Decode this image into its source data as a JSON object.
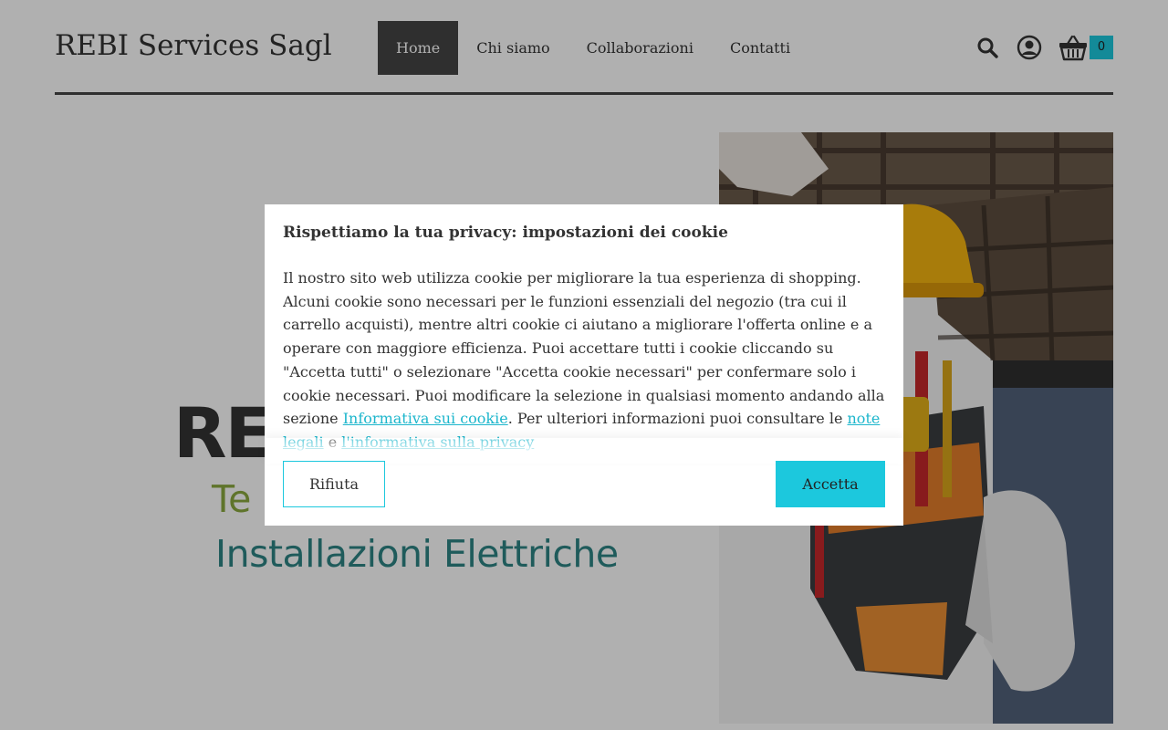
{
  "header": {
    "brand": "REBI Services Sagl",
    "nav": [
      {
        "label": "Home"
      },
      {
        "label": "Chi siamo"
      },
      {
        "label": "Collaborazioni"
      },
      {
        "label": "Contatti"
      }
    ],
    "icons": [
      "search-icon",
      "user-icon",
      "basket-icon"
    ],
    "cart_count": "0"
  },
  "hero": {
    "logo_word": "REBI",
    "logo_sub": "Te",
    "logo_tagline": "Installazioni Elettriche"
  },
  "cookie_modal": {
    "title": "Rispettiamo la tua privacy: impostazioni dei cookie",
    "body_text": "Il nostro sito web utilizza cookie per migliorare la tua esperienza di shopping. Alcuni cookie sono necessari per le funzioni essenziali del negozio (tra cui il carrello acquisti), mentre altri cookie ci aiutano a migliorare l'offerta online e a operare con maggiore efficienza. Puoi accettare tutti i cookie cliccando su \"Accetta tutti\" o selezionare \"Accetta cookie necessari\" per confermare solo i cookie necessari. Puoi modificare la selezione in qualsiasi momento andando alla sezione",
    "link_cookie_policy": "Informativa sui cookie",
    "text_middle": ". Per ulteriori informazioni puoi consultare le",
    "link_legal": "note legali",
    "text_and": "e",
    "link_privacy": "l'informativa sulla privacy",
    "reject_label": "Rifiuta",
    "accept_label": "Accetta"
  },
  "colors": {
    "accent": "#1cc8dd",
    "nav_active_bg": "#444444",
    "overlay": "rgba(0,0,0,0.31)",
    "logo_green": "#8aa83f",
    "logo_teal": "#2d8585"
  }
}
